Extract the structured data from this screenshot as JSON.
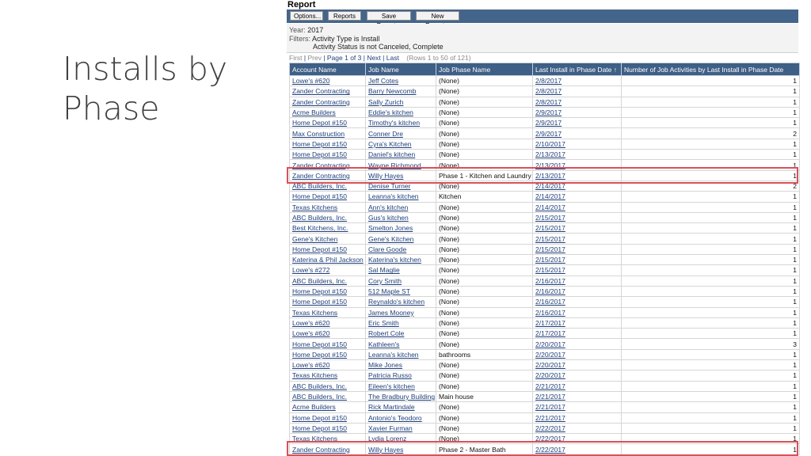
{
  "slide": {
    "title": "Installs by Phase"
  },
  "report": {
    "title": "Report",
    "toolbar": {
      "options": "Options...",
      "reports": "Reports ▾",
      "save": "Save Report...",
      "new": "New Report..."
    },
    "year_label": "Year:",
    "year_value": "2017",
    "filters_label": "Filters:",
    "filter_1": "Activity Type is Install",
    "filter_2": "Activity Status is not Canceled, Complete",
    "pager": {
      "first": "First",
      "prev": "Prev",
      "page": "Page 1 of 3",
      "next": "Next",
      "last": "Last",
      "rows": "(Rows 1 to 50 of 121)"
    },
    "columns": [
      "Account Name",
      "Job Name",
      "Job Phase Name",
      "Last Install in Phase Date ↑",
      "Number of Job Activities by Last Install in Phase Date"
    ],
    "rows": [
      [
        "Lowe's #620",
        "Jeff Cotes",
        "(None)",
        "2/8/2017",
        "1"
      ],
      [
        "Zander Contracting",
        "Barry Newcomb",
        "(None)",
        "2/8/2017",
        "1"
      ],
      [
        "Zander Contracting",
        "Sally Zurich",
        "(None)",
        "2/8/2017",
        "1"
      ],
      [
        "Acme Builders",
        "Eddie's kitchen",
        "(None)",
        "2/9/2017",
        "1"
      ],
      [
        "Home Depot #150",
        "Timothy's kitchen",
        "(None)",
        "2/9/2017",
        "1"
      ],
      [
        "Max Construction",
        "Conner Dre",
        "(None)",
        "2/9/2017",
        "2"
      ],
      [
        "Home Depot #150",
        "Cyra's Kitchen",
        "(None)",
        "2/10/2017",
        "1"
      ],
      [
        "Home Depot #150",
        "Daniel's kitchen",
        "(None)",
        "2/13/2017",
        "1"
      ],
      [
        "Zander Contracting",
        "Wayne Richmond",
        "(None)",
        "2/13/2017",
        "1"
      ],
      [
        "Zander Contracting",
        "Willy Hayes",
        "Phase 1 - Kitchen and Laundry",
        "2/13/2017",
        "1"
      ],
      [
        "ABC Builders, Inc.",
        "Denise Turner",
        "(None)",
        "2/14/2017",
        "2"
      ],
      [
        "Home Depot #150",
        "Leanna's kitchen",
        "Kitchen",
        "2/14/2017",
        "1"
      ],
      [
        "Texas Kitchens",
        "Ann's kitchen",
        "(None)",
        "2/14/2017",
        "1"
      ],
      [
        "ABC Builders, Inc.",
        "Gus's kitchen",
        "(None)",
        "2/15/2017",
        "1"
      ],
      [
        "Best Kitchens, Inc.",
        "Smelton Jones",
        "(None)",
        "2/15/2017",
        "1"
      ],
      [
        "Gene's Kitchen",
        "Gene's Kitchen",
        "(None)",
        "2/15/2017",
        "1"
      ],
      [
        "Home Depot #150",
        "Clare Goode",
        "(None)",
        "2/15/2017",
        "1"
      ],
      [
        "Katerina & Phil Jackson",
        "Katerina's kitchen",
        "(None)",
        "2/15/2017",
        "1"
      ],
      [
        "Lowe's #272",
        "Sal Maglie",
        "(None)",
        "2/15/2017",
        "1"
      ],
      [
        "ABC Builders, Inc.",
        "Cory Smith",
        "(None)",
        "2/16/2017",
        "1"
      ],
      [
        "Home Depot #150",
        "512 Maple ST",
        "(None)",
        "2/16/2017",
        "1"
      ],
      [
        "Home Depot #150",
        "Reynaldo's kitchen",
        "(None)",
        "2/16/2017",
        "1"
      ],
      [
        "Texas Kitchens",
        "James Mooney",
        "(None)",
        "2/16/2017",
        "1"
      ],
      [
        "Lowe's #620",
        "Eric Smith",
        "(None)",
        "2/17/2017",
        "1"
      ],
      [
        "Lowe's #620",
        "Robert Cole",
        "(None)",
        "2/17/2017",
        "1"
      ],
      [
        "Home Depot #150",
        "Kathleen's",
        "(None)",
        "2/20/2017",
        "3"
      ],
      [
        "Home Depot #150",
        "Leanna's kitchen",
        "bathrooms",
        "2/20/2017",
        "1"
      ],
      [
        "Lowe's #620",
        "Mike Jones",
        "(None)",
        "2/20/2017",
        "1"
      ],
      [
        "Texas Kitchens",
        "Patricia Russo",
        "(None)",
        "2/20/2017",
        "1"
      ],
      [
        "ABC Builders, Inc.",
        "Eileen's kitchen",
        "(None)",
        "2/21/2017",
        "1"
      ],
      [
        "ABC Builders, Inc.",
        "The Bradbury Building",
        "Main house",
        "2/21/2017",
        "1"
      ],
      [
        "Acme Builders",
        "Rick Martindale",
        "(None)",
        "2/21/2017",
        "1"
      ],
      [
        "Home Depot #150",
        "Antonio's Teodoro",
        "(None)",
        "2/21/2017",
        "1"
      ],
      [
        "Home Depot #150",
        "Xavier Furman",
        "(None)",
        "2/22/2017",
        "1"
      ],
      [
        "Texas Kitchens",
        "Lydia Lorenz",
        "(None)",
        "2/22/2017",
        "1"
      ],
      [
        "Zander Contracting",
        "Willy Hayes",
        "Phase 2 - Master Bath",
        "2/22/2017",
        "1"
      ]
    ],
    "highlighted_rows": [
      9,
      35
    ]
  }
}
